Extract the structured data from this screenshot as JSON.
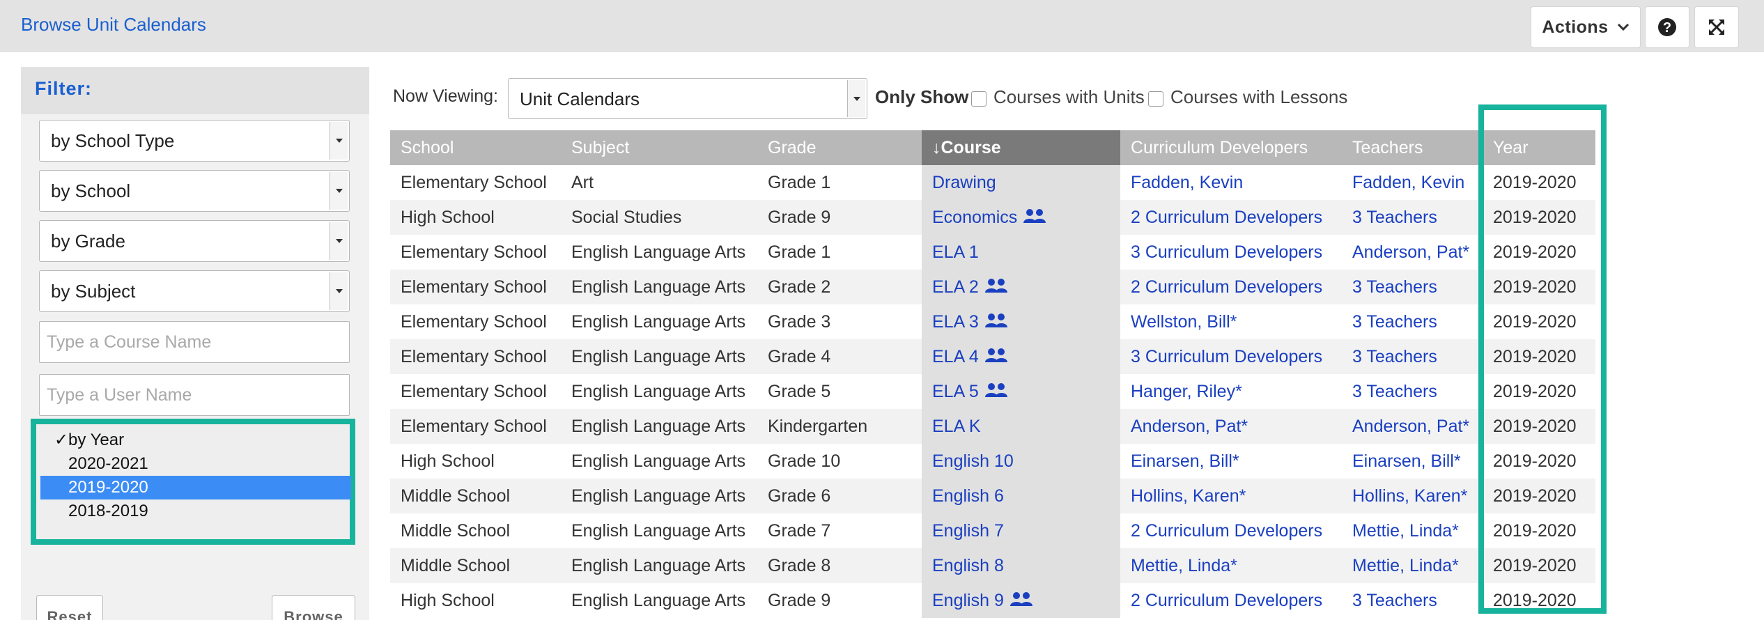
{
  "header": {
    "breadcrumb": "Browse Unit Calendars",
    "actions_label": "Actions",
    "icons": [
      "chevron-down-icon",
      "help-icon",
      "expand-icon"
    ]
  },
  "filter": {
    "title": "Filter:",
    "selects": [
      "by School Type",
      "by School",
      "by Grade",
      "by Subject"
    ],
    "course_placeholder": "Type a Course Name",
    "user_placeholder": "Type a User Name",
    "year_options": [
      {
        "label": "by Year",
        "checked": true,
        "highlighted": false
      },
      {
        "label": "2020-2021",
        "checked": false,
        "highlighted": false
      },
      {
        "label": "2019-2020",
        "checked": false,
        "highlighted": true
      },
      {
        "label": "2018-2019",
        "checked": false,
        "highlighted": false
      }
    ],
    "reset_label": "Reset",
    "browse_label": "Browse"
  },
  "toolbar": {
    "now_viewing_label": "Now Viewing:",
    "now_viewing_value": "Unit Calendars",
    "only_show_label": "Only Show",
    "courses_with_units": "Courses with Units",
    "courses_with_lessons": "Courses with Lessons"
  },
  "table": {
    "headers": [
      "School",
      "Subject",
      "Grade",
      "↓Course",
      "Curriculum Developers",
      "Teachers",
      "Year"
    ],
    "rows": [
      {
        "school": "Elementary School",
        "subject": "Art",
        "grade": "Grade 1",
        "course": "Drawing",
        "group": false,
        "developers": "Fadden, Kevin",
        "teachers": "Fadden, Kevin",
        "year": "2019-2020"
      },
      {
        "school": "High School",
        "subject": "Social Studies",
        "grade": "Grade 9",
        "course": "Economics",
        "group": true,
        "developers": "2 Curriculum Developers",
        "teachers": "3 Teachers",
        "year": "2019-2020"
      },
      {
        "school": "Elementary School",
        "subject": "English Language Arts",
        "grade": "Grade 1",
        "course": "ELA 1",
        "group": false,
        "developers": "3 Curriculum Developers",
        "teachers": "Anderson, Pat*",
        "year": "2019-2020"
      },
      {
        "school": "Elementary School",
        "subject": "English Language Arts",
        "grade": "Grade 2",
        "course": "ELA 2",
        "group": true,
        "developers": "2 Curriculum Developers",
        "teachers": "3 Teachers",
        "year": "2019-2020"
      },
      {
        "school": "Elementary School",
        "subject": "English Language Arts",
        "grade": "Grade 3",
        "course": "ELA 3",
        "group": true,
        "developers": "Wellston, Bill*",
        "teachers": "3 Teachers",
        "year": "2019-2020"
      },
      {
        "school": "Elementary School",
        "subject": "English Language Arts",
        "grade": "Grade 4",
        "course": "ELA 4",
        "group": true,
        "developers": "3 Curriculum Developers",
        "teachers": "3 Teachers",
        "year": "2019-2020"
      },
      {
        "school": "Elementary School",
        "subject": "English Language Arts",
        "grade": "Grade 5",
        "course": "ELA 5",
        "group": true,
        "developers": "Hanger, Riley*",
        "teachers": "3 Teachers",
        "year": "2019-2020"
      },
      {
        "school": "Elementary School",
        "subject": "English Language Arts",
        "grade": "Kindergarten",
        "course": "ELA K",
        "group": false,
        "developers": "Anderson, Pat*",
        "teachers": "Anderson, Pat*",
        "year": "2019-2020"
      },
      {
        "school": "High School",
        "subject": "English Language Arts",
        "grade": "Grade 10",
        "course": "English 10",
        "group": false,
        "developers": "Einarsen, Bill*",
        "teachers": "Einarsen, Bill*",
        "year": "2019-2020"
      },
      {
        "school": "Middle School",
        "subject": "English Language Arts",
        "grade": "Grade 6",
        "course": "English 6",
        "group": false,
        "developers": "Hollins, Karen*",
        "teachers": "Hollins, Karen*",
        "year": "2019-2020"
      },
      {
        "school": "Middle School",
        "subject": "English Language Arts",
        "grade": "Grade 7",
        "course": "English 7",
        "group": false,
        "developers": "2 Curriculum Developers",
        "teachers": "Mettie, Linda*",
        "year": "2019-2020"
      },
      {
        "school": "Middle School",
        "subject": "English Language Arts",
        "grade": "Grade 8",
        "course": "English 8",
        "group": false,
        "developers": "Mettie, Linda*",
        "teachers": "Mettie, Linda*",
        "year": "2019-2020"
      },
      {
        "school": "High School",
        "subject": "English Language Arts",
        "grade": "Grade 9",
        "course": "English 9",
        "group": true,
        "developers": "2 Curriculum Developers",
        "teachers": "3 Teachers",
        "year": "2019-2020"
      }
    ]
  },
  "colors": {
    "link": "#1a3fc0",
    "accent_highlight": "#18b39c",
    "header_bg": "#b8b8b8",
    "sorted_header_bg": "#7a7a7a",
    "selected_option": "#3b8cf5"
  }
}
